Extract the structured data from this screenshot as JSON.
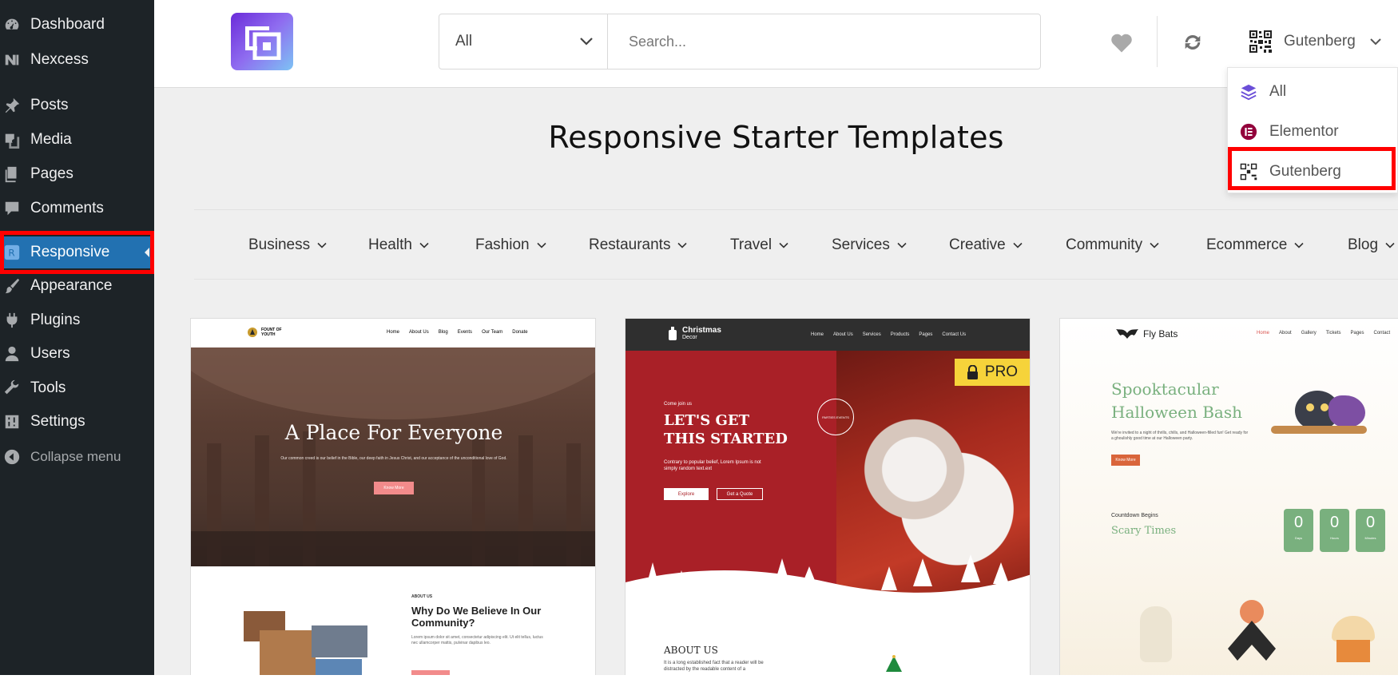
{
  "sidebar": {
    "items": [
      {
        "label": "Dashboard",
        "icon": "dashboard-icon"
      },
      {
        "label": "Nexcess",
        "icon": "nexcess-icon"
      },
      {
        "label": "Posts",
        "icon": "pin-icon"
      },
      {
        "label": "Media",
        "icon": "media-icon"
      },
      {
        "label": "Pages",
        "icon": "pages-icon"
      },
      {
        "label": "Comments",
        "icon": "comment-icon"
      },
      {
        "label": "Responsive",
        "icon": "responsive-icon",
        "active": true
      },
      {
        "label": "Appearance",
        "icon": "brush-icon"
      },
      {
        "label": "Plugins",
        "icon": "plugin-icon"
      },
      {
        "label": "Users",
        "icon": "user-icon"
      },
      {
        "label": "Tools",
        "icon": "wrench-icon"
      },
      {
        "label": "Settings",
        "icon": "settings-icon"
      },
      {
        "label": "Collapse menu",
        "icon": "collapse-icon"
      }
    ]
  },
  "header": {
    "search_filter": "All",
    "search_placeholder": "Search...",
    "builder_label": "Gutenberg"
  },
  "builder_dropdown": {
    "items": [
      {
        "label": "All",
        "icon": "layers-icon"
      },
      {
        "label": "Elementor",
        "icon": "elementor-icon"
      },
      {
        "label": "Gutenberg",
        "icon": "gutenberg-qr-icon",
        "highlighted": true
      }
    ]
  },
  "main": {
    "title": "Responsive Starter Templates",
    "categories": [
      "Business",
      "Health",
      "Fashion",
      "Restaurants",
      "Travel",
      "Services",
      "Creative",
      "Community",
      "Ecommerce",
      "Blog"
    ]
  },
  "cards": [
    {
      "brand": "FOUNT OF YOUTH",
      "nav": [
        "Home",
        "About Us",
        "Blog",
        "Events",
        "Our Team",
        "Donate"
      ],
      "hero_title": "A Place For Everyone",
      "hero_text": "Our common creed is our belief in the Bible, our deep faith in Jesus Christ, and our acceptance of the unconditional love of God.",
      "hero_button": "Know More",
      "section_label": "ABOUT US",
      "section_title": "Why Do We Believe In Our Community?",
      "section_text": "Lorem ipsum dolor sit amet, consectetur adipiscing elit. Ut elit tellus, luctus nec ullamcorper mattis, pulvinar dapibus leo."
    },
    {
      "brand": "Christmas",
      "brand_sub": "Decor",
      "nav": [
        "Home",
        "About Us",
        "Services",
        "Products",
        "Pages",
        "Contact Us"
      ],
      "badge": "PRO",
      "kicker": "Come join us",
      "hero_title_1": "LET'S GET",
      "hero_title_2": "THIS STARTED",
      "hero_text": "Contrary to popular belief, Lorem Ipsum is not simply random text.ext",
      "btn1": "Explore",
      "btn2": "Get a Quote",
      "stamp": "PARTIES EVENTS",
      "section_title": "ABOUT US",
      "section_text": "It is a long established fact that a reader will be distracted by the readable content of a"
    },
    {
      "brand": "Fly Bats",
      "nav": [
        "Home",
        "About",
        "Gallery",
        "Tickets",
        "Pages",
        "Contact"
      ],
      "hero_title_1": "Spooktacular",
      "hero_title_2": "Halloween Bash",
      "hero_text": "We're invited to a night of thrills, chills, and Halloween-filled fun! Get ready for a ghoulishly good time at our Halloween party.",
      "hero_button": "Know More",
      "countdown_label": "Countdown Begins",
      "countdown_title": "Scary Times",
      "counters": [
        {
          "value": "0",
          "unit": "Days"
        },
        {
          "value": "0",
          "unit": "Hours"
        },
        {
          "value": "0",
          "unit": "Minutes"
        }
      ]
    }
  ],
  "colors": {
    "sidebar_bg": "#1d2327",
    "active_bg": "#2271b1",
    "highlight_red": "#ff0000",
    "pro_yellow": "#f6d33a",
    "christmas_red": "#a92027",
    "halloween_green": "#79b07e"
  }
}
